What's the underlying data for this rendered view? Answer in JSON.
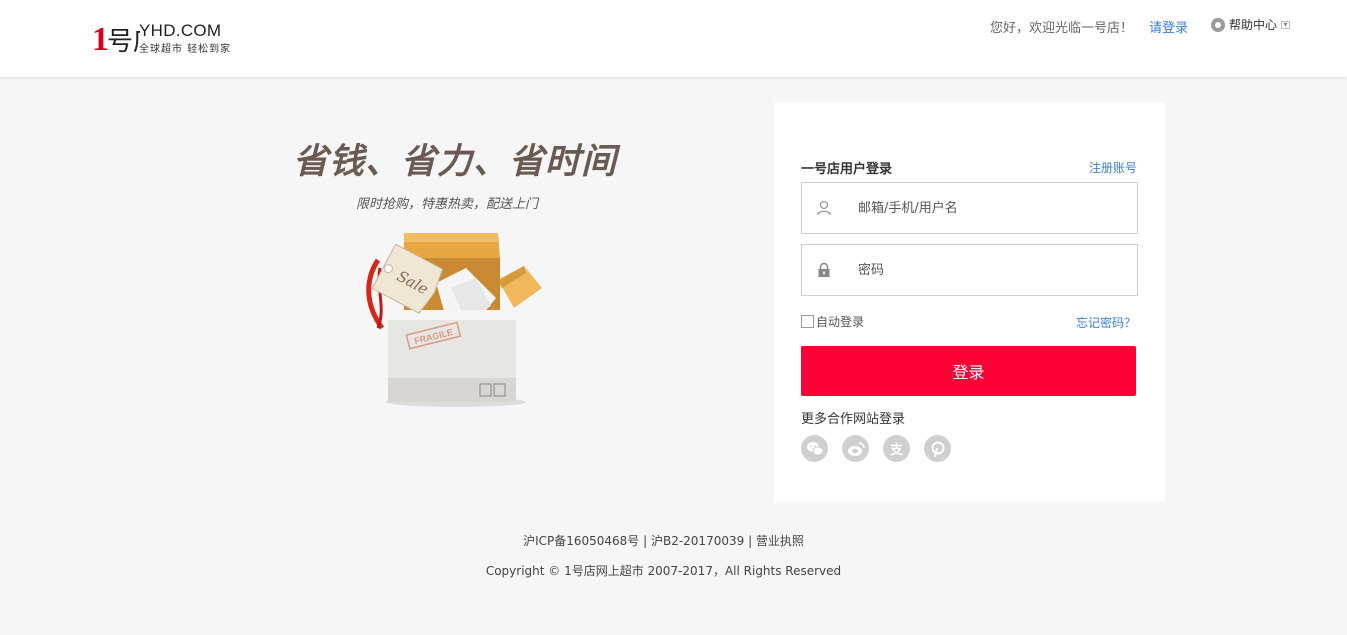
{
  "header": {
    "logo_number": "1号店",
    "logo_domain": "YHD.COM",
    "logo_slogan": "全球超市 轻松到家",
    "welcome": "您好，欢迎光临一号店！",
    "login_link": "请登录",
    "help": "帮助中心"
  },
  "hero": {
    "title": "省钱、省力、省时间",
    "subtitle": "限时抢购，特惠热卖，配送上门",
    "tag_text": "Sale",
    "box_label": "FRAGILE"
  },
  "login": {
    "title": "一号店用户登录",
    "register": "注册账号",
    "username_placeholder": "邮箱/手机/用户名",
    "password_placeholder": "密码",
    "auto_login": "自动登录",
    "forgot": "忘记密码？",
    "submit": "登录",
    "more": "更多合作网站登录",
    "socials": [
      "wechat-icon",
      "weibo-icon",
      "alipay-icon",
      "pinterest-icon"
    ]
  },
  "footer": {
    "icp": "沪ICP备16050468号",
    "sep1": " | ",
    "b2": "沪B2-20170039",
    "sep2": " | ",
    "license": "营业执照",
    "copyright": "Copyright © 1号店网上超市 2007-2017，All Rights Reserved"
  },
  "colors": {
    "accent": "#ff0036",
    "link": "#3a7fd4",
    "brand_red": "#d6001c"
  }
}
